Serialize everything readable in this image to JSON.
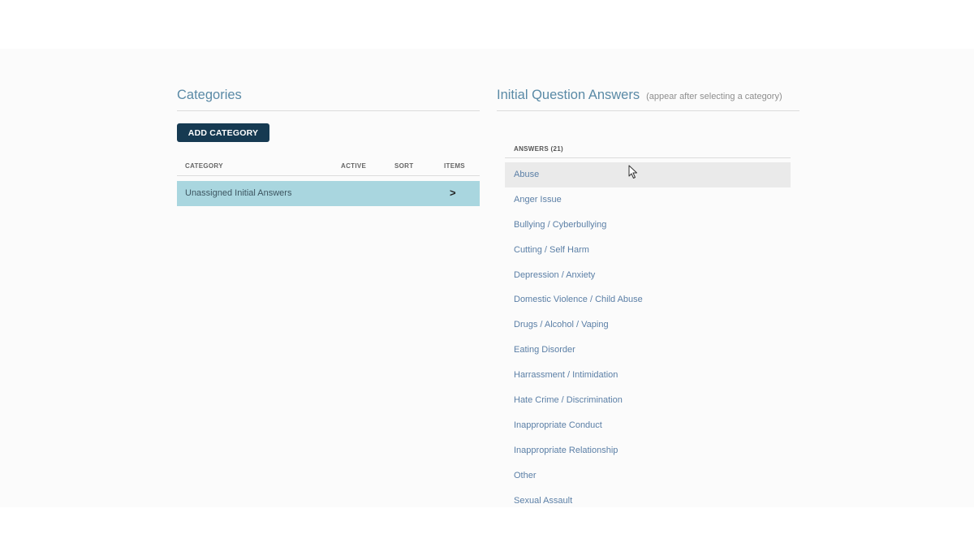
{
  "categories_panel": {
    "title": "Categories",
    "add_button_label": "ADD CATEGORY",
    "columns": {
      "category": "CATEGORY",
      "active": "ACTIVE",
      "sort": "SORT",
      "items": "ITEMS"
    },
    "rows": [
      {
        "name": "Unassigned Initial Answers",
        "arrow": ">"
      }
    ]
  },
  "answers_panel": {
    "title": "Initial Question Answers",
    "subtitle": "(appear after selecting a category)",
    "header": "ANSWERS (21)",
    "items": [
      "Abuse",
      "Anger Issue",
      "Bullying / Cyberbullying",
      "Cutting / Self Harm",
      "Depression / Anxiety",
      "Domestic Violence / Child Abuse",
      "Drugs / Alcohol / Vaping",
      "Eating Disorder",
      "Harrassment / Intimidation",
      "Hate Crime / Discrimination",
      "Inappropriate Conduct",
      "Inappropriate Relationship",
      "Other",
      "Sexual Assault"
    ]
  },
  "colors": {
    "title": "#5a8aa6",
    "button_bg": "#163a52",
    "selected_row": "#a9d6df",
    "answer_text": "#5b7fa6",
    "hover_row": "#eaeaea"
  },
  "icons": {
    "cursor": "mouse-pointer-icon"
  }
}
